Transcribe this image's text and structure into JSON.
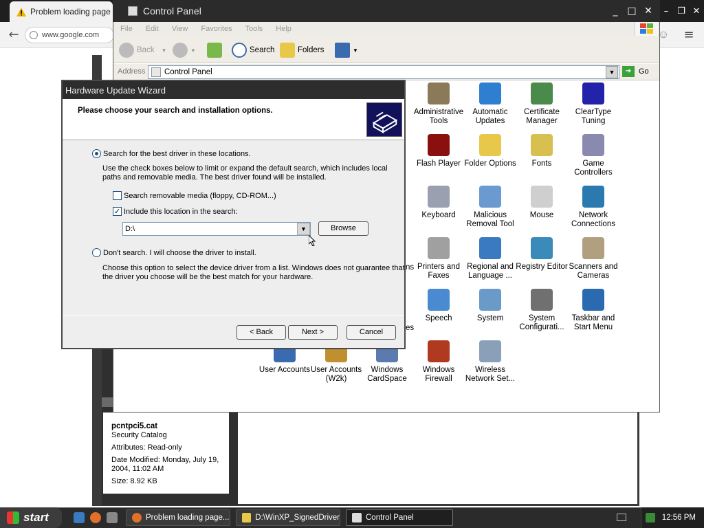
{
  "browser": {
    "tab_title": "Problem loading page",
    "url": "www.google.com",
    "window_controls": [
      "–",
      "❐",
      "✕"
    ]
  },
  "control_panel": {
    "title": "Control Panel",
    "window_controls": [
      "_",
      "□",
      "✕"
    ],
    "menu": [
      "File",
      "Edit",
      "View",
      "Favorites",
      "Tools",
      "Help"
    ],
    "toolbar": {
      "back": "Back",
      "search": "Search",
      "folders": "Folders"
    },
    "address_label": "Address",
    "address_value": "Control Panel",
    "go_label": "Go",
    "icons": [
      {
        "label": "Administrative Tools",
        "icon": "admin-tools-icon",
        "color": "#8a7a5a"
      },
      {
        "label": "Automatic Updates",
        "icon": "windows-update-icon",
        "color": "#2f7fd0"
      },
      {
        "label": "Certificate Manager",
        "icon": "certificate-icon",
        "color": "#4a8a4a"
      },
      {
        "label": "ClearType Tuning",
        "icon": "cleartype-icon",
        "color": "#2222aa"
      },
      {
        "label": "Flash Player",
        "icon": "flash-icon",
        "color": "#8a1010"
      },
      {
        "label": "Folder Options",
        "icon": "folder-options-icon",
        "color": "#e8c84a"
      },
      {
        "label": "Fonts",
        "icon": "fonts-folder-icon",
        "color": "#d8c050"
      },
      {
        "label": "Game Controllers",
        "icon": "gamepad-icon",
        "color": "#8a8ab0"
      },
      {
        "label": "Keyboard",
        "icon": "keyboard-icon",
        "color": "#9aa0b0"
      },
      {
        "label": "Malicious Removal Tool",
        "icon": "removal-tool-icon",
        "color": "#6a9ad0"
      },
      {
        "label": "Mouse",
        "icon": "mouse-icon",
        "color": "#cfcfcf"
      },
      {
        "label": "Network Connections",
        "icon": "network-globe-icon",
        "color": "#2a7ab0"
      },
      {
        "label": "Printers and Faxes",
        "icon": "printer-icon",
        "color": "#a0a0a0"
      },
      {
        "label": "Regional and Language ...",
        "icon": "globe-icon",
        "color": "#3a7ac0"
      },
      {
        "label": "Registry Editor",
        "icon": "registry-icon",
        "color": "#3a8aba"
      },
      {
        "label": "Scanners and Cameras",
        "icon": "scanner-icon",
        "color": "#b0a080"
      },
      {
        "label": "Speech",
        "icon": "speech-icon",
        "color": "#4a8ad0"
      },
      {
        "label": "System",
        "icon": "system-icon",
        "color": "#6a9ac8"
      },
      {
        "label": "System Configurati...",
        "icon": "system-config-icon",
        "color": "#707070"
      },
      {
        "label": "Taskbar and Start Menu",
        "icon": "taskbar-icon",
        "color": "#2a6ab0"
      },
      {
        "label": "User Accounts",
        "icon": "user-accounts-icon",
        "color": "#3a6ab0"
      },
      {
        "label": "User Accounts (W2k)",
        "icon": "user-accounts-keys-icon",
        "color": "#c09030"
      },
      {
        "label": "Windows CardSpace",
        "icon": "cardspace-icon",
        "color": "#5a7ab0"
      },
      {
        "label": "Windows Firewall",
        "icon": "firewall-icon",
        "color": "#b03a20"
      },
      {
        "label": "Wireless Network Set...",
        "icon": "wireless-icon",
        "color": "#8aa0b8"
      }
    ],
    "partial_labels": [
      "ns",
      "es"
    ]
  },
  "file_info": {
    "name": "pcntpci5.cat",
    "type": "Security Catalog",
    "attributes": "Attributes: Read-only",
    "modified_1": "Date Modified: Monday, July 19,",
    "modified_2": "2004, 11:02 AM",
    "size": "Size: 8.92 KB"
  },
  "wizard": {
    "title": "Hardware Update Wizard",
    "heading": "Please choose your search and installation options.",
    "option_search": "Search for the best driver in these locations.",
    "search_desc_1": "Use the check boxes below to limit or expand the default search, which includes local",
    "search_desc_2": "paths and removable media. The best driver found will be installed.",
    "chk_removable": "Search removable media (floppy, CD-ROM...)",
    "chk_location": "Include this location in the search:",
    "location_value": "D:\\",
    "browse": "Browse",
    "option_dont": "Don't search. I will choose the driver to install.",
    "dont_desc_1": "Choose this option to select the device driver from a list.  Windows does not guarantee that",
    "dont_desc_2": "the driver you choose will be the best match for your hardware.",
    "back": "< Back",
    "next": "Next >",
    "cancel": "Cancel",
    "search_selected": true,
    "removable_checked": false,
    "location_checked": true
  },
  "taskbar": {
    "start": "start",
    "tasks": [
      {
        "label": "Problem loading page...",
        "icon": "firefox-icon"
      },
      {
        "label": "D:\\WinXP_SignedDriver",
        "icon": "folder-icon"
      },
      {
        "label": "Control Panel",
        "icon": "control-panel-icon"
      }
    ],
    "clock": "12:56 PM"
  }
}
